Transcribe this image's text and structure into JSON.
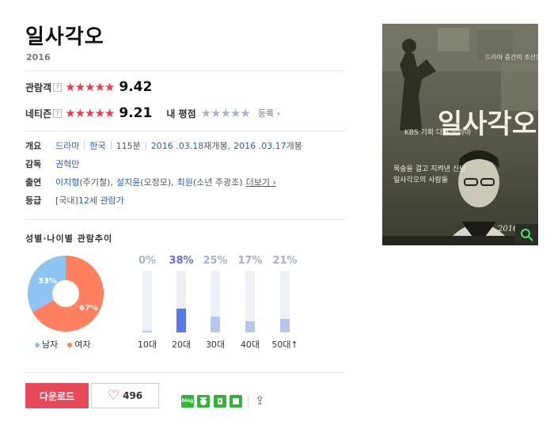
{
  "movie": {
    "title": "일사각오",
    "year": "2016"
  },
  "ratings": {
    "audience": {
      "label": "관람객",
      "help": "?",
      "stars": "★★★★★",
      "score": "9.42"
    },
    "netizen": {
      "label": "네티즌",
      "help": "?",
      "stars": "★★★★★",
      "score": "9.21"
    },
    "mine": {
      "label": "내 평점",
      "stars": "★★★★★",
      "register": "등록 ›"
    }
  },
  "info": {
    "overview": {
      "label": "개요",
      "genre": "드라마",
      "country": "한국",
      "runtime": "115분",
      "release1_date": "2016 .03.18",
      "release1_suffix": " 재개봉,",
      "release2_date": "2016 .03.17",
      "release2_suffix": " 개봉"
    },
    "director": {
      "label": "감독",
      "name": "권혁만"
    },
    "cast": {
      "label": "출연",
      "actor1": "이지형",
      "role1": "(주기철),",
      "actor2": "설지윤",
      "role2": "(오정모),",
      "actor3": "최원",
      "role3": "(소년 주광조)",
      "more": "더보기 ›"
    },
    "grade": {
      "label": "등급",
      "value": "[국내] ",
      "rating": "12세 관람가"
    }
  },
  "trend": {
    "title": "성별·나이별 관람추이",
    "gender": {
      "male_pct": 33,
      "female_pct": 67,
      "male_label": "33%",
      "female_label": "67%",
      "male_legend": "남자",
      "female_legend": "여자",
      "male_color": "#8fc4f2",
      "female_color": "#ff7f5e"
    },
    "ages": [
      {
        "label": "10대",
        "pct_text": "0%",
        "value": 0.02
      },
      {
        "label": "20대",
        "pct_text": "38%",
        "value": 0.38,
        "highlight": true
      },
      {
        "label": "30대",
        "pct_text": "25%",
        "value": 0.25
      },
      {
        "label": "40대",
        "pct_text": "17%",
        "value": 0.17
      },
      {
        "label": "50대↑",
        "pct_text": "21%",
        "value": 0.21
      }
    ]
  },
  "actions": {
    "download": "다운로드",
    "like_count": "496",
    "sns": [
      {
        "name": "blog-icon",
        "color": "#3cb43c",
        "text": "blog"
      },
      {
        "name": "cafe-icon",
        "color": "#3cb43c",
        "text": ""
      },
      {
        "name": "band-icon",
        "color": "#3cb43c",
        "text": ""
      },
      {
        "name": "memo-icon",
        "color": "#3cb43c",
        "text": ""
      }
    ]
  },
  "poster": {
    "title": "일사각오",
    "tagline_top": "드라마 중간의 조선인 마을의 도시",
    "tagline_mid1": "목숨을 걸고 지켜낸 신념",
    "tagline_mid2": "일사각오의 사람들",
    "year": "2016",
    "channel": "KBS 기획 다큐 드라마"
  }
}
